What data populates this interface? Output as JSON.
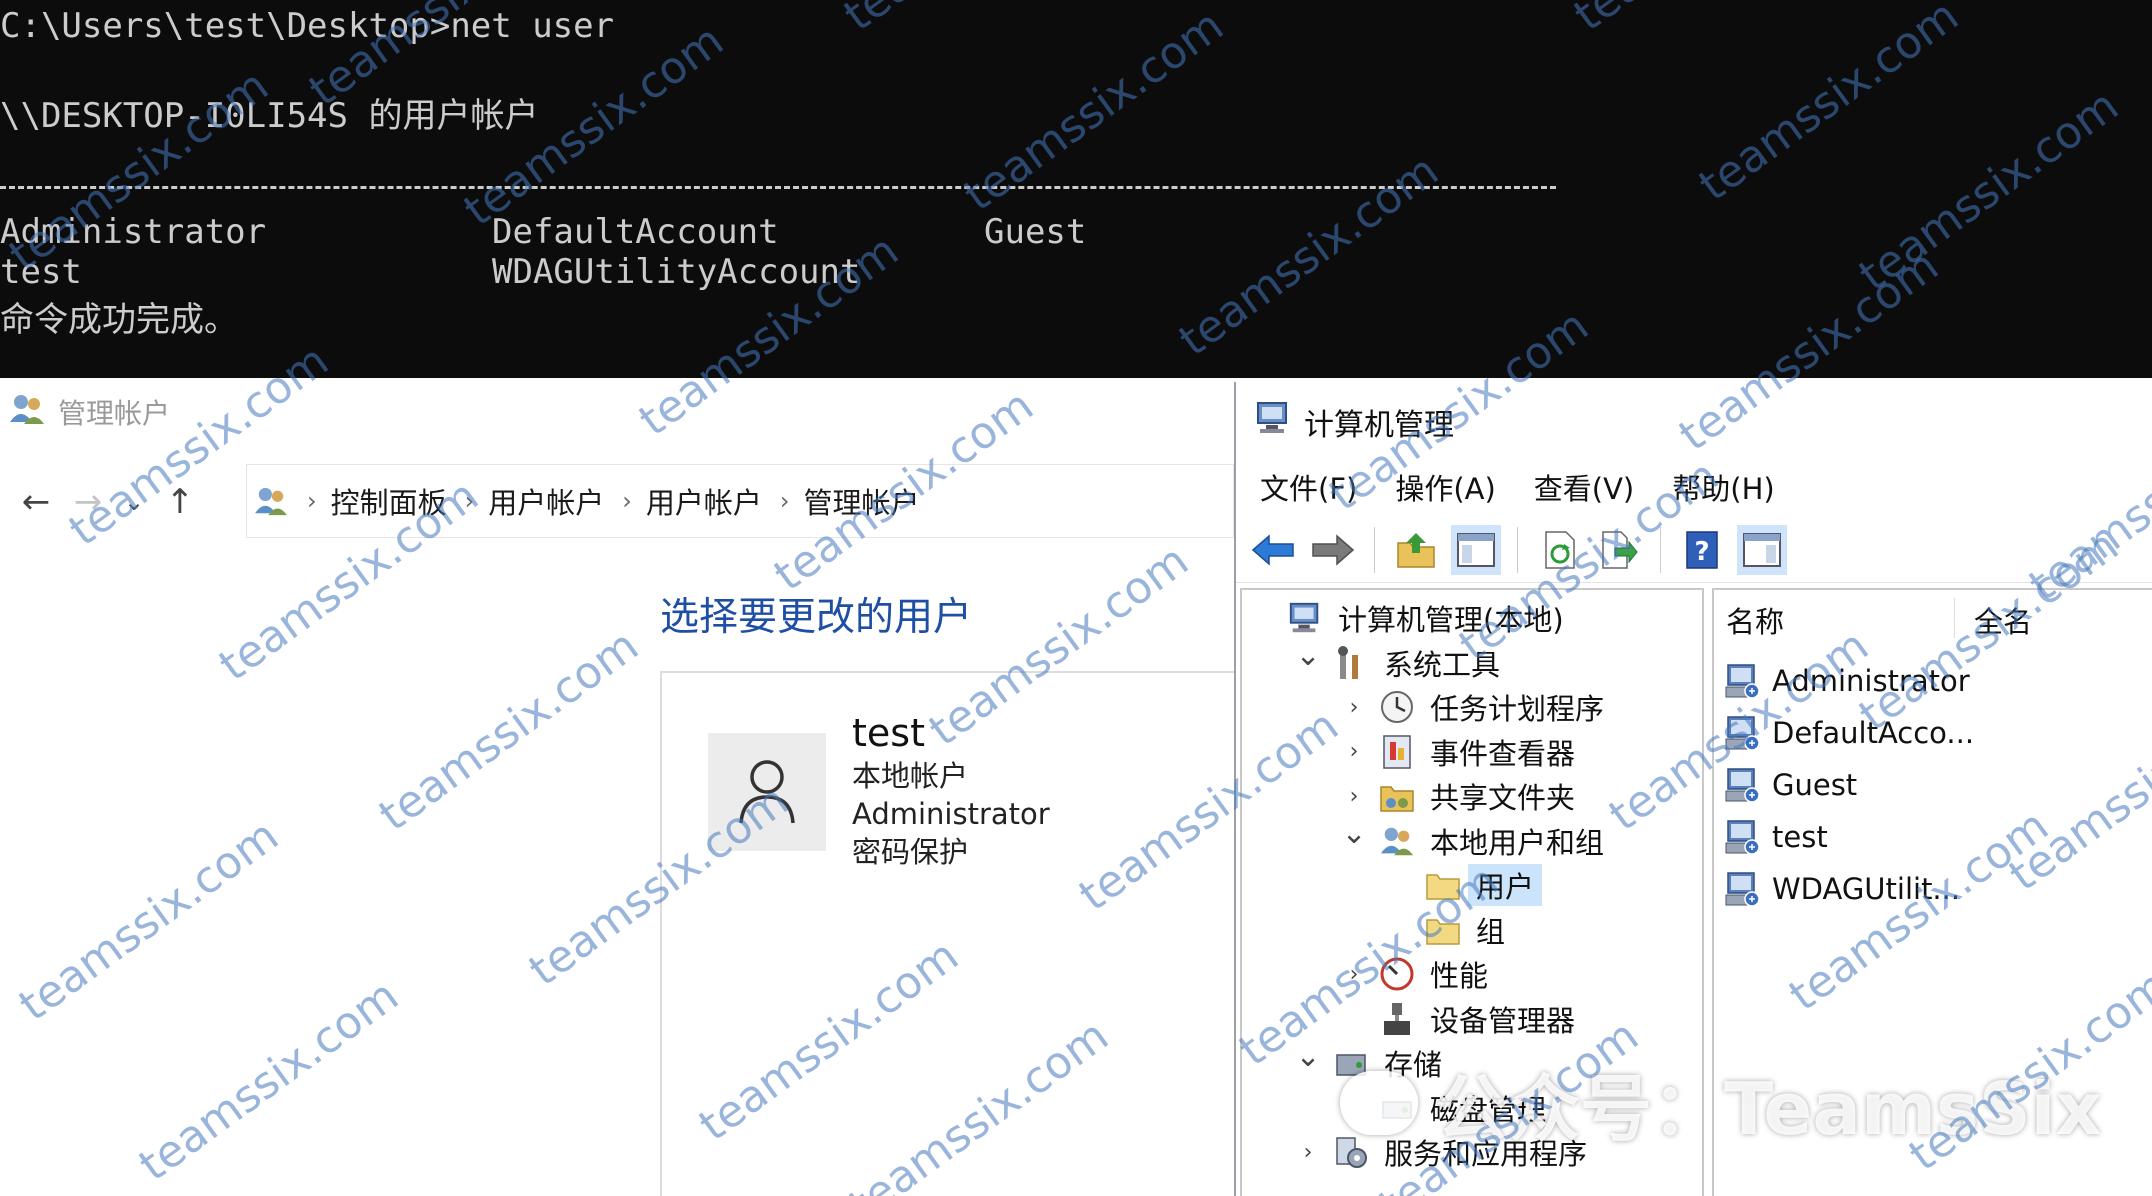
{
  "console": {
    "prompt_line": "C:\\Users\\test\\Desktop>net user",
    "header_line": "\\\\DESKTOP-I0LI54S 的用户帐户",
    "accounts_row1": [
      "Administrator",
      "DefaultAccount",
      "Guest"
    ],
    "accounts_row2": [
      "test",
      "WDAGUtilityAccount"
    ],
    "result_line": "命令成功完成。"
  },
  "control_panel": {
    "window_title": "管理帐户",
    "breadcrumb": [
      "控制面板",
      "用户帐户",
      "用户帐户",
      "管理帐户"
    ],
    "heading": "选择要更改的用户",
    "user_card": {
      "name": "test",
      "lines": [
        "本地帐户",
        "Administrator",
        "密码保护"
      ]
    }
  },
  "computer_management": {
    "window_title": "计算机管理",
    "menu": [
      "文件(F)",
      "操作(A)",
      "查看(V)",
      "帮助(H)"
    ],
    "toolbar": [
      "back-arrow-icon",
      "forward-arrow-icon",
      "up-folder-icon",
      "show-hide-tree-icon",
      "refresh-icon",
      "export-list-icon",
      "help-icon",
      "action-pane-icon"
    ],
    "tree": [
      {
        "label": "计算机管理(本地)",
        "level": 0,
        "expander": "none",
        "icon": "computer-management-icon"
      },
      {
        "label": "系统工具",
        "level": 1,
        "expander": "expanded",
        "icon": "system-tools-icon"
      },
      {
        "label": "任务计划程序",
        "level": 2,
        "expander": "collapsed",
        "icon": "clock-icon"
      },
      {
        "label": "事件查看器",
        "level": 2,
        "expander": "collapsed",
        "icon": "event-viewer-icon"
      },
      {
        "label": "共享文件夹",
        "level": 2,
        "expander": "collapsed",
        "icon": "shared-folder-icon"
      },
      {
        "label": "本地用户和组",
        "level": 2,
        "expander": "expanded",
        "icon": "users-groups-icon"
      },
      {
        "label": "用户",
        "level": 3,
        "expander": "none",
        "icon": "folder-icon",
        "selected": true
      },
      {
        "label": "组",
        "level": 3,
        "expander": "none",
        "icon": "folder-icon"
      },
      {
        "label": "性能",
        "level": 2,
        "expander": "collapsed",
        "icon": "performance-icon"
      },
      {
        "label": "设备管理器",
        "level": 2,
        "expander": "none",
        "icon": "device-manager-icon"
      },
      {
        "label": "存储",
        "level": 1,
        "expander": "expanded",
        "icon": "storage-icon"
      },
      {
        "label": "磁盘管理",
        "level": 2,
        "expander": "none",
        "icon": "disk-icon"
      },
      {
        "label": "服务和应用程序",
        "level": 1,
        "expander": "collapsed",
        "icon": "services-icon"
      }
    ],
    "columns": [
      "名称",
      "全名"
    ],
    "users": [
      "Administrator",
      "DefaultAcco...",
      "Guest",
      "test",
      "WDAGUtilit..."
    ]
  },
  "watermark": {
    "text": "teamssix.com",
    "wechat": "公众号：TeamsSix"
  },
  "colors": {
    "console_bg": "#0c0c0c",
    "console_fg": "#cccccc",
    "heading_blue": "#1e4fa5",
    "selection": "#cce4fb",
    "watermark": "#4678be"
  }
}
